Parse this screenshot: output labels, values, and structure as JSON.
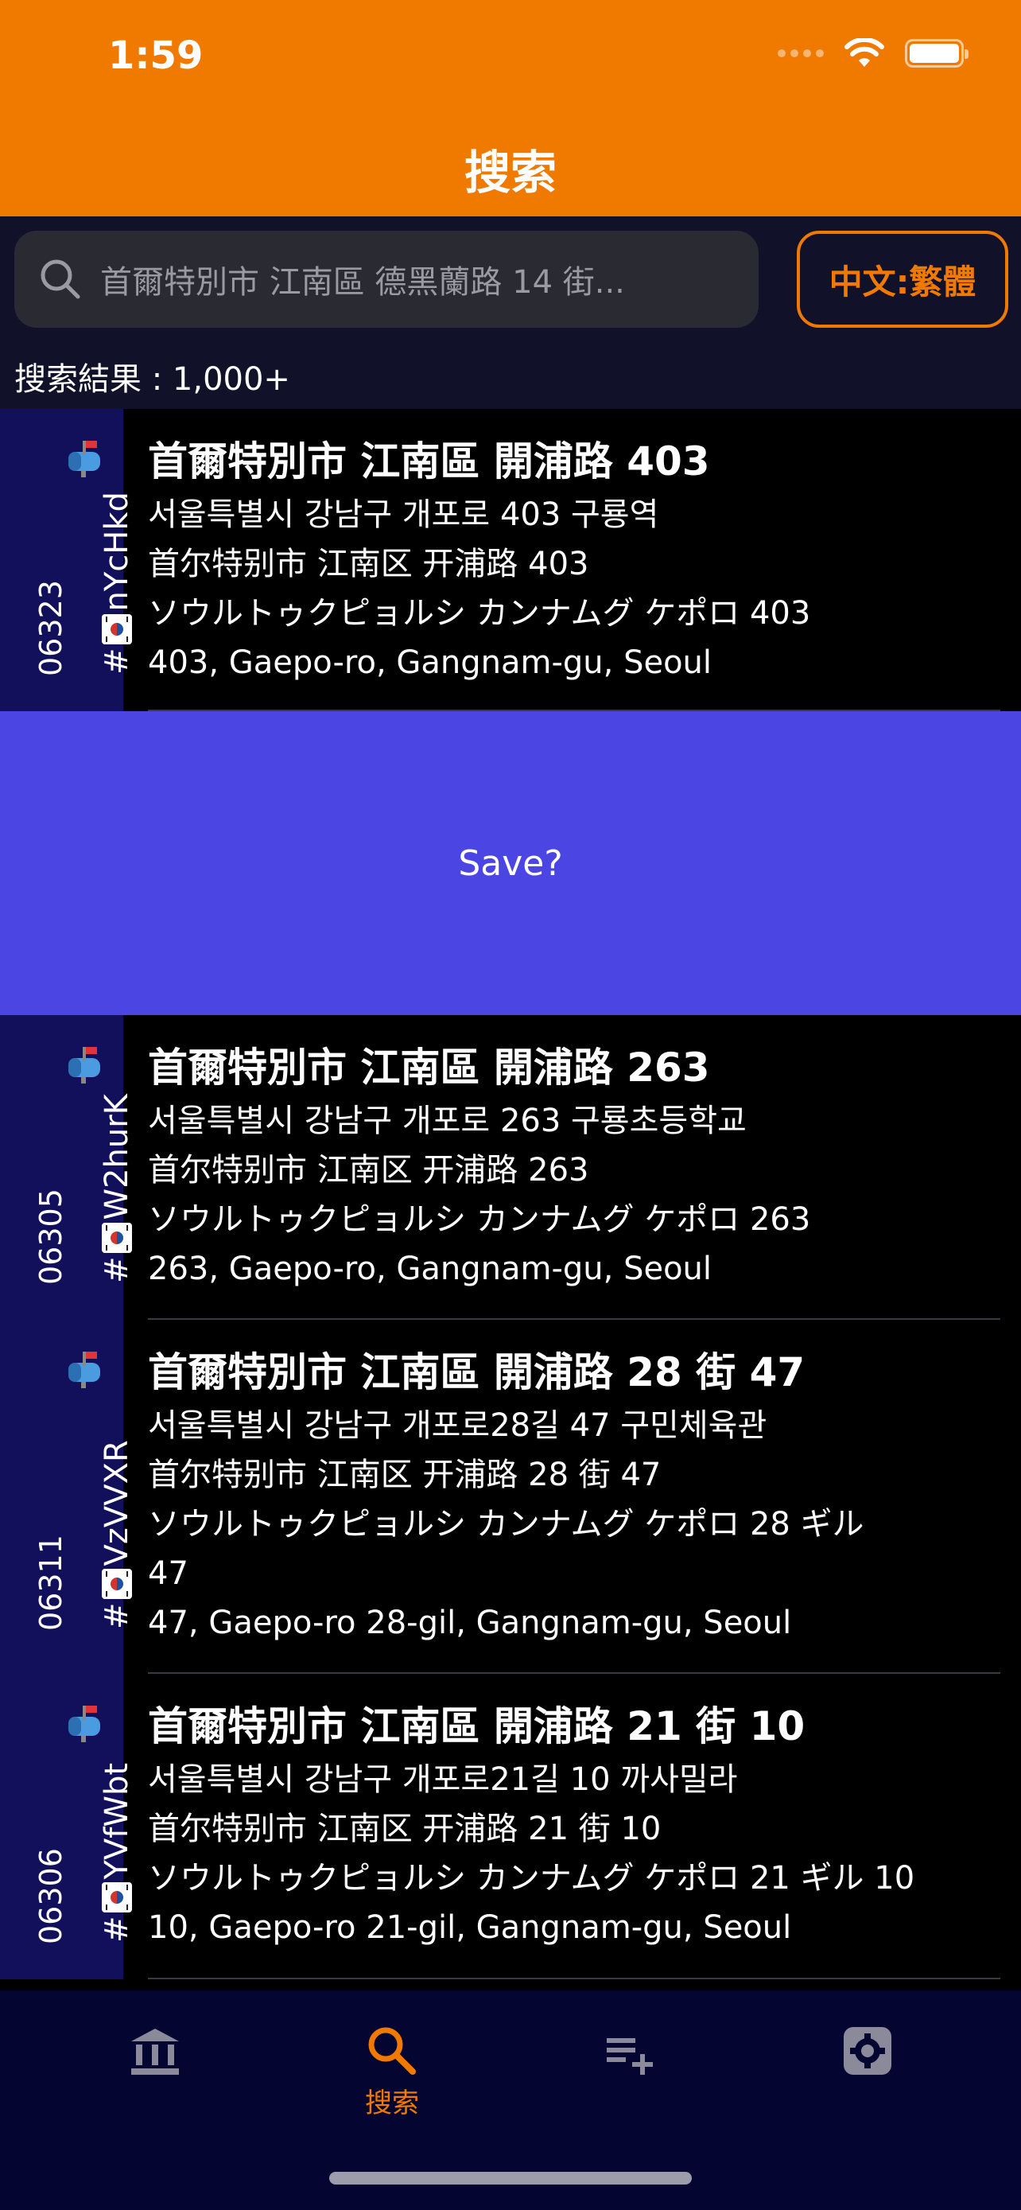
{
  "status": {
    "time": "1:59"
  },
  "header": {
    "title": "搜索"
  },
  "search": {
    "placeholder": "首爾特別市 江南區  德黑蘭路 14 街...",
    "language_button": "中文:繁體",
    "result_count": "搜索結果 : 1,000+"
  },
  "save_band": {
    "label": "Save?"
  },
  "rows": [
    {
      "zip": "06323",
      "code": "nYcHkd",
      "title": "首爾特別市 江南區 開浦路 403",
      "lines": [
        "서울특별시 강남구 개포로 403 구룡역",
        "首尔特别市 江南区 开浦路 403",
        "ソウルトゥクピョルシ カンナムグ ケポロ 403",
        "403, Gaepo-ro, Gangnam-gu, Seoul"
      ]
    },
    {
      "zip": "06305",
      "code": "W2hurK",
      "title": "首爾特別市 江南區 開浦路 263",
      "lines": [
        "서울특별시 강남구 개포로 263 구룡초등학교",
        "首尔特别市 江南区 开浦路 263",
        "ソウルトゥクピョルシ カンナムグ ケポロ 263",
        "263, Gaepo-ro, Gangnam-gu, Seoul"
      ]
    },
    {
      "zip": "06311",
      "code": "VzVVXR",
      "title": "首爾特別市 江南區 開浦路 28 街 47",
      "lines": [
        "서울특별시 강남구 개포로28길 47 구민체육관",
        "首尔特别市 江南区 开浦路 28 街 47",
        "ソウルトゥクピョルシ カンナムグ ケポロ 28 ギル",
        "47",
        "47, Gaepo-ro 28-gil, Gangnam-gu, Seoul"
      ]
    },
    {
      "zip": "06306",
      "code": "YVfWbt",
      "title": "首爾特別市 江南區 開浦路 21 街 10",
      "lines": [
        "서울특별시 강남구 개포로21길 10 까사밀라",
        "首尔特别市 江南区 开浦路 21 街 10",
        "ソウルトゥクピョルシ カンナムグ ケポロ 21 ギル 10",
        "10, Gaepo-ro 21-gil, Gangnam-gu, Seoul"
      ]
    }
  ],
  "tabs": [
    {
      "icon": "bank-icon",
      "label": ""
    },
    {
      "icon": "search-icon",
      "label": "搜索"
    },
    {
      "icon": "playlist-add-icon",
      "label": ""
    },
    {
      "icon": "settings-icon",
      "label": ""
    }
  ],
  "colors": {
    "accent": "#F07A00",
    "search_bg": "#12112A",
    "side_bg": "#12105A",
    "save_bg": "#4B46E3",
    "tabbar_bg": "#050531"
  }
}
